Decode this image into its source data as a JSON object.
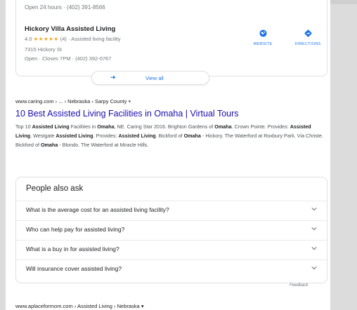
{
  "local": {
    "prev_hours": "Open 24 hours · (402) 391-8566",
    "name": "Hickory Villa Assisted Living",
    "rating": "4.0",
    "stars": "★★★★★",
    "reviews": "(4) · Assisted living facility",
    "address": "7315 Hickory St",
    "hours": "Open · Closes 7PM · (402) 392-0767",
    "website_label": "WEBSITE",
    "directions_label": "DIRECTIONS",
    "view_all": "View all"
  },
  "result": {
    "breadcrumb": "www.caring.com › ... › Nebraska › Sarpy County",
    "dropdown_caret": "▾",
    "title": "10 Best Assisted Living Facilities in Omaha | Virtual Tours",
    "snippet": [
      {
        "t": "Top 10 ",
        "b": false
      },
      {
        "t": "Assisted Living",
        "b": true
      },
      {
        "t": " Facilities in ",
        "b": false
      },
      {
        "t": "Omaha",
        "b": true
      },
      {
        "t": ", NE. Caring Star 2016. Brighton Gardens of ",
        "b": false
      },
      {
        "t": "Omaha",
        "b": true
      },
      {
        "t": ". Crown Pointe. Provides: ",
        "b": false
      },
      {
        "t": "Assisted Living",
        "b": true
      },
      {
        "t": ". Westgate ",
        "b": false
      },
      {
        "t": "Assisted Living",
        "b": true
      },
      {
        "t": ". Provides: ",
        "b": false
      },
      {
        "t": "Assisted Living",
        "b": true
      },
      {
        "t": ". Bickford of ",
        "b": false
      },
      {
        "t": "Omaha",
        "b": true
      },
      {
        "t": " - Hickory. The Waterford at Roxbury Park. Via Christe. Bickford of ",
        "b": false
      },
      {
        "t": "Omaha",
        "b": true
      },
      {
        "t": " - Blondo. The Waterford at Miracle Hills.",
        "b": false
      }
    ]
  },
  "paa": {
    "title": "People also ask",
    "questions": [
      "What is the average cost for an assisted living facility?",
      "Who can help pay for assisted living?",
      "What is a buy in for assisted living?",
      "Will insurance cover assisted living?"
    ],
    "feedback": "Feedback"
  },
  "next_result": {
    "url": "www.aplaceformom.com › Assisted Living › Nebraska",
    "caret": "▾"
  },
  "colors": {
    "link_title": "#1a0dab",
    "accent_blue": "#1a73e8",
    "star": "#f5a623"
  }
}
